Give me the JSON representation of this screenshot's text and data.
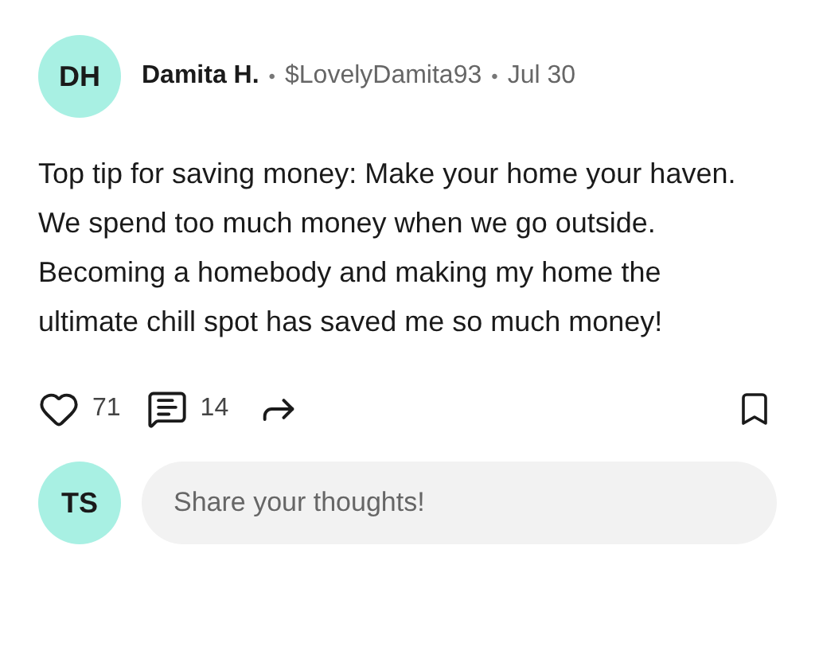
{
  "post": {
    "avatar_initials": "DH",
    "author": "Damita H.",
    "handle": "$LovelyDamita93",
    "date": "Jul 30",
    "separators": [
      "•",
      "•"
    ],
    "body": "Top tip for saving money: Make your home your haven. We spend too much money when we go outside. Becoming a homebody and making my home the ultimate chill spot has saved me so much money!",
    "likes": "71",
    "comments": "14",
    "liked": false,
    "bookmarked": false
  },
  "comment_box": {
    "avatar_initials": "TS",
    "placeholder": "Share your thoughts!"
  }
}
